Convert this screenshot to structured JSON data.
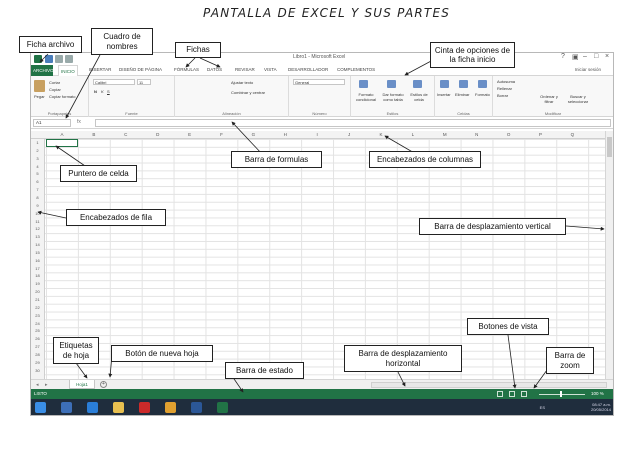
{
  "heading": "PANTALLA DE EXCEL Y SUS PARTES",
  "colors": {
    "excel_green": "#217346",
    "taskbar": "#1f2d3d"
  },
  "excel": {
    "window_title": "Libro1 - Microsoft Excel",
    "window_controls": [
      "?",
      "▣",
      "–",
      "□",
      "×"
    ],
    "user": "Iniciar sesión",
    "tabs": [
      "ARCHIVO",
      "INICIO",
      "INSERTAR",
      "DISEÑO DE PÁGINA",
      "FÓRMULAS",
      "DATOS",
      "REVISAR",
      "VISTA",
      "DESARROLLADOR",
      "COMPLEMENTOS"
    ],
    "active_tab": "INICIO",
    "ribbon": {
      "groups": [
        "Portapapeles",
        "Fuente",
        "Alineación",
        "Número",
        "Estilos",
        "Celdas",
        "Modificar"
      ],
      "paste": "Pegar",
      "cut": "Cortar",
      "copy": "Copiar",
      "format_painter": "Copiar formato",
      "font": "Calibri",
      "font_size": "11",
      "wrap": "Ajustar texto",
      "merge": "Combinar y centrar",
      "number_format": "General",
      "cond_format": "Formato condicional",
      "as_table": "Dar formato como tabla",
      "cell_styles": "Estilos de celda",
      "insert": "Insertar",
      "delete": "Eliminar",
      "format": "Formato",
      "autosum": "Autosuma",
      "fill": "Rellenar",
      "clear": "Borrar",
      "sort": "Ordenar y filtrar",
      "find": "Buscar y seleccionar"
    },
    "name_box": "A1",
    "fx": "fx",
    "columns": [
      "A",
      "B",
      "C",
      "D",
      "E",
      "F",
      "G",
      "H",
      "I",
      "J",
      "K",
      "L",
      "M",
      "N",
      "O",
      "P",
      "Q"
    ],
    "rows": [
      "1",
      "2",
      "3",
      "4",
      "5",
      "6",
      "7",
      "8",
      "9",
      "10",
      "11",
      "12",
      "13",
      "14",
      "15",
      "16",
      "17",
      "18",
      "19",
      "20",
      "21",
      "22",
      "23",
      "24",
      "25",
      "26",
      "27",
      "28",
      "29",
      "30"
    ],
    "sheet_tab": "Hoja1",
    "new_sheet": "+",
    "status": "LISTO",
    "zoom": "100 %",
    "clock": {
      "time": "08:47 a.m.",
      "date": "20/05/2014"
    },
    "tray_lang": "ES"
  },
  "callouts": {
    "ficha_archivo": "Ficha archivo",
    "cuadro_nombres": "Cuadro de nombres",
    "fichas": "Fichas",
    "cinta": "Cinta de opciones de la ficha inicio",
    "barra_formulas": "Barra de formulas",
    "encabezados_columnas": "Encabezados de columnas",
    "puntero_celda": "Puntero de celda",
    "encabezados_fila": "Encabezados de fila",
    "barra_vertical": "Barra de desplazamiento vertical",
    "botones_vista": "Botones de vista",
    "etiquetas_hoja": "Etiquetas de hoja",
    "nueva_hoja": "Botón de nueva hoja",
    "barra_horizontal": "Barra de desplazamiento horizontal",
    "barra_estado": "Barra de estado",
    "barra_zoom": "Barra de zoom"
  }
}
